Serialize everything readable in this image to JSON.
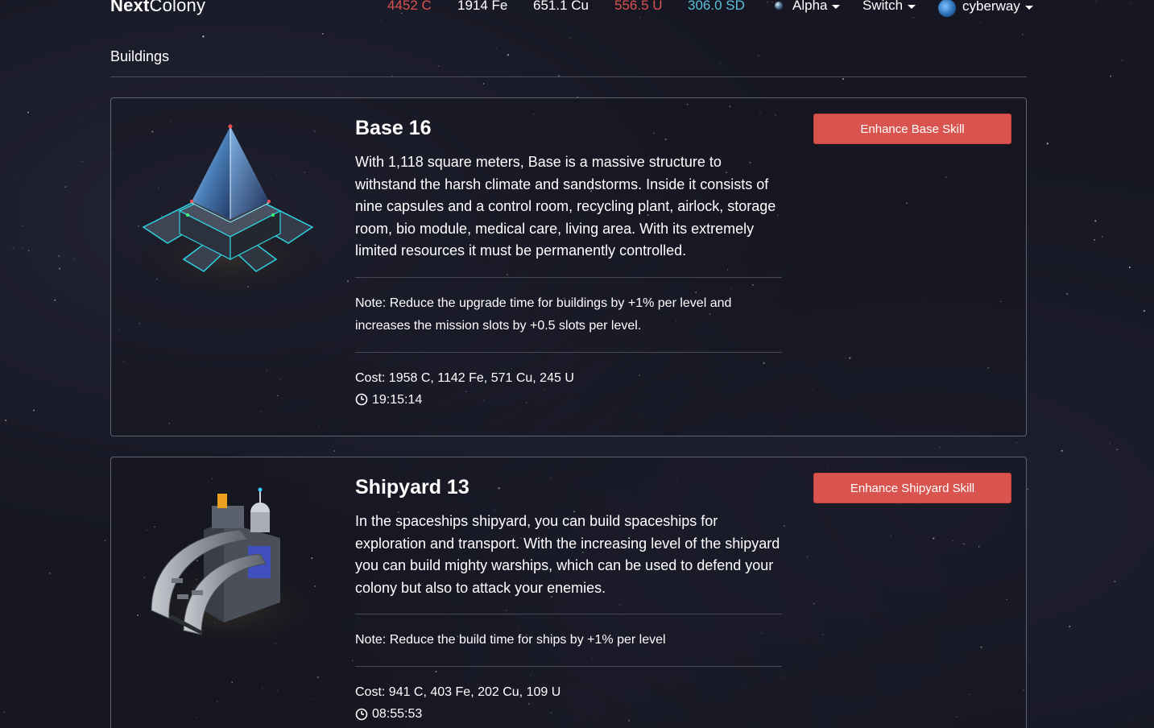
{
  "nav": {
    "brand_bold": "Next",
    "brand_rest": "Colony",
    "resources": [
      {
        "label": "4452 C",
        "color": "#d9534f"
      },
      {
        "label": "1914 Fe",
        "color": "#ffffff"
      },
      {
        "label": "651.1 Cu",
        "color": "#ffffff"
      },
      {
        "label": "556.5 U",
        "color": "#d9534f"
      },
      {
        "label": "306.0 SD",
        "color": "#5bc0de"
      }
    ],
    "planet_menu": "Alpha",
    "switch_menu": "Switch",
    "user_menu": "cyberway"
  },
  "section": {
    "title": "Buildings"
  },
  "buildings": [
    {
      "title": "Base 16",
      "description": "With 1,118 square meters, Base is a massive structure to withstand the harsh climate and sandstorms. Inside it consists of nine capsules and a control room, recycling plant, airlock, storage room, bio module, medical care, living area. With its extremely limited resources it must be permanently controlled.",
      "note": "Note: Reduce the upgrade time for buildings by +1% per level and increases the mission slots by +0.5 slots per level.",
      "cost": "Cost: 1958 C, 1142 Fe, 571 Cu, 245 U",
      "time": "19:15:14",
      "button": "Enhance Base Skill",
      "image_icon": "pyramid-base-icon"
    },
    {
      "title": "Shipyard 13",
      "description": "In the spaceships shipyard, you can build spaceships for exploration and transport. With the increasing level of the shipyard you can build mighty warships, which can be used to defend your colony but also to attack your enemies.",
      "note": "Note: Reduce the build time for ships by +1% per level",
      "cost": "Cost: 941 C, 403 Fe, 202 Cu, 109 U",
      "time": "08:55:53",
      "button": "Enhance Shipyard Skill",
      "image_icon": "shipyard-hangar-icon"
    }
  ],
  "colors": {
    "accent_red": "#d9534f",
    "accent_blue": "#5bc0de",
    "background": "#161722"
  }
}
